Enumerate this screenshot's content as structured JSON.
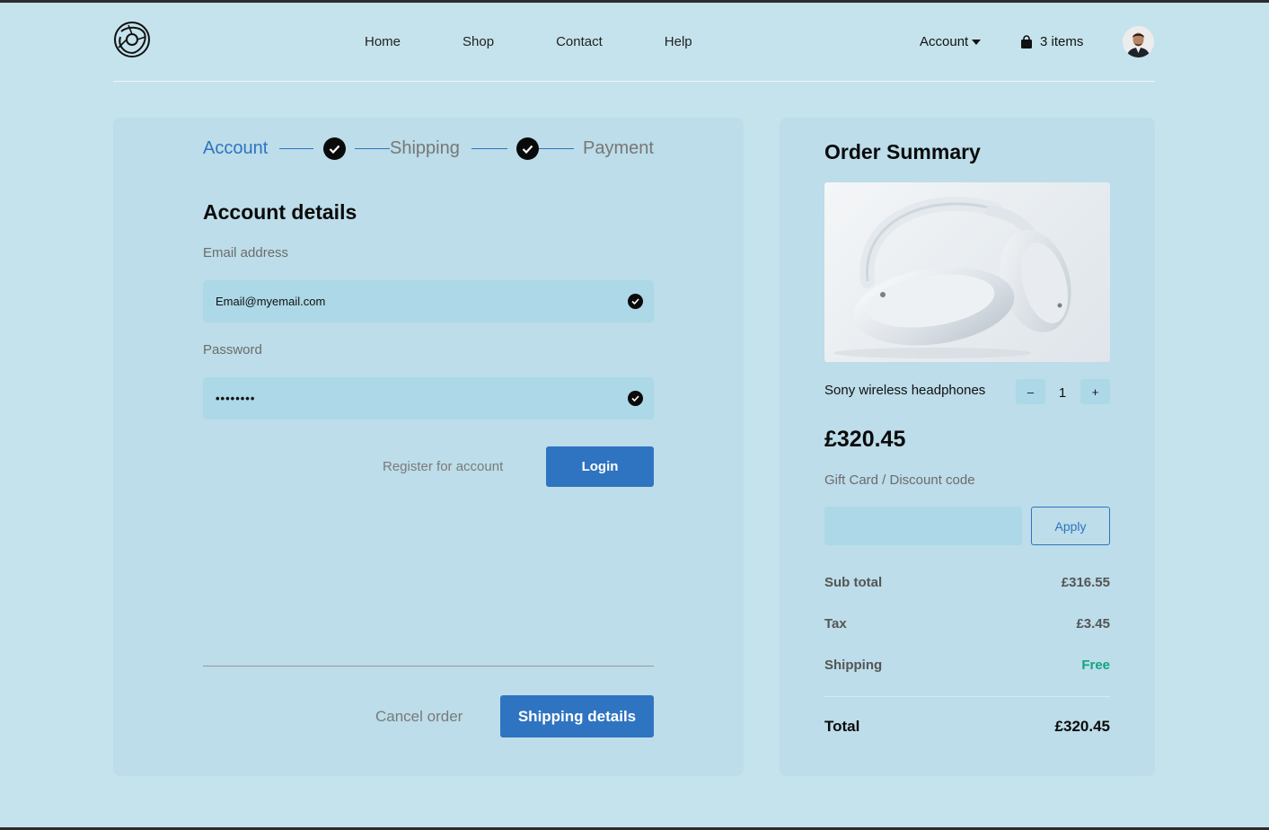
{
  "header": {
    "nav": [
      "Home",
      "Shop",
      "Contact",
      "Help"
    ],
    "account_label": "Account",
    "cart_label": "3 items"
  },
  "stepper": {
    "steps": [
      "Account",
      "Shipping",
      "Payment"
    ],
    "active_step": "Account"
  },
  "form": {
    "title": "Account details",
    "email_label": "Email address",
    "email_value": "Email@myemail.com",
    "password_label": "Password",
    "password_value": "••••••••",
    "register_label": "Register for account",
    "login_label": "Login",
    "cancel_label": "Cancel order",
    "next_label": "Shipping details"
  },
  "summary": {
    "title": "Order Summary",
    "product_name": "Sony wireless headphones",
    "qty_minus": "–",
    "qty_value": "1",
    "qty_plus": "+",
    "price": "£320.45",
    "gift_label": "Gift Card / Discount code",
    "gift_value": "",
    "apply_label": "Apply",
    "rows": [
      {
        "label": "Sub total",
        "value": "£316.55"
      },
      {
        "label": "Tax",
        "value": "£3.45"
      },
      {
        "label": "Shipping",
        "value": "Free"
      }
    ],
    "total_label": "Total",
    "total_value": "£320.45"
  },
  "colors": {
    "background": "#c5e3ec",
    "panel": "#bcdde9",
    "accent": "#2f74c0",
    "free": "#14a37f"
  }
}
